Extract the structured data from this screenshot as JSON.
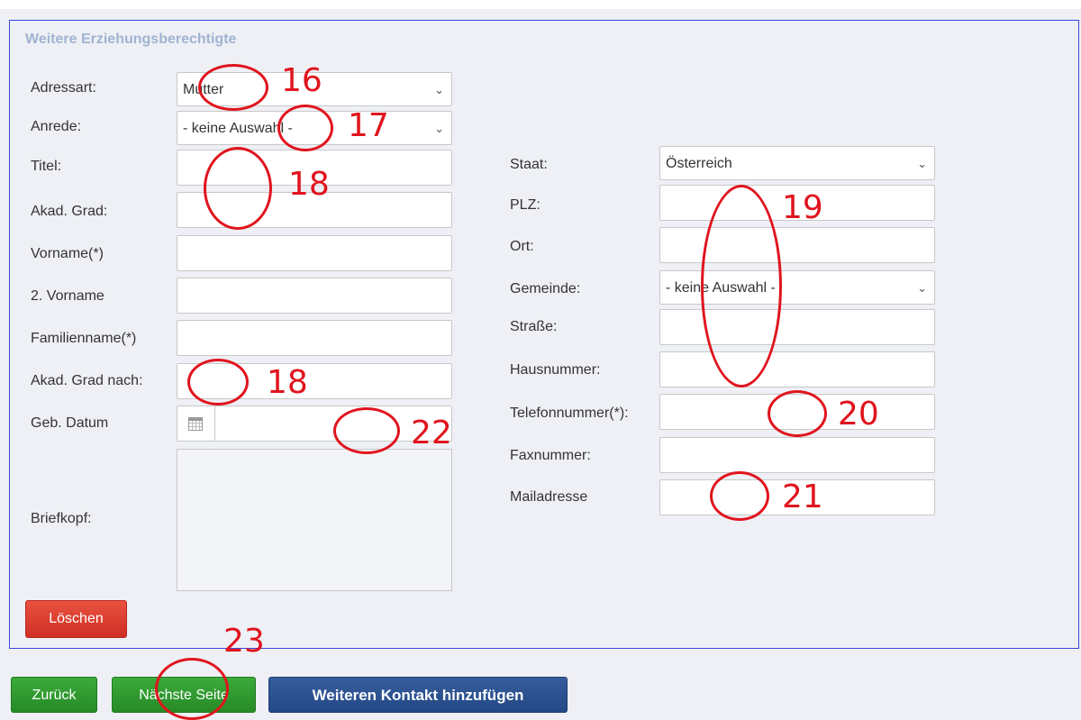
{
  "section_title": "Weitere Erziehungsberechtigte",
  "left": {
    "adressart_label": "Adressart:",
    "adressart_value": "Mutter",
    "anrede_label": "Anrede:",
    "anrede_value": "- keine Auswahl -",
    "titel_label": "Titel:",
    "akad_grad_label": "Akad. Grad:",
    "vorname_label": "Vorname(*)",
    "vorname2_label": "2. Vorname",
    "familienname_label": "Familienname(*)",
    "akad_grad_nach_label": "Akad. Grad nach:",
    "geb_datum_label": "Geb. Datum",
    "briefkopf_label": "Briefkopf:"
  },
  "right": {
    "staat_label": "Staat:",
    "staat_value": "Österreich",
    "plz_label": "PLZ:",
    "ort_label": "Ort:",
    "gemeinde_label": "Gemeinde:",
    "gemeinde_value": "- keine Auswahl -",
    "strasse_label": "Straße:",
    "hausnummer_label": "Hausnummer:",
    "telefon_label": "Telefonnummer(*):",
    "fax_label": "Faxnummer:",
    "mail_label": "Mailadresse"
  },
  "buttons": {
    "loeschen": "Löschen",
    "zurueck": "Zurück",
    "naechste": "Nächste Seite",
    "weiteren": "Weiteren Kontakt hinzufügen"
  },
  "annotations": [
    "16",
    "17",
    "18",
    "18",
    "22",
    "19",
    "20",
    "21",
    "23"
  ],
  "colors": {
    "annotation": "#e0141e",
    "panel_border": "#3a48d6",
    "section_title": "#9fb3d1",
    "delete_button": "#d9372c",
    "green_button": "#2e9a2e",
    "blue_button": "#2c4f8f"
  },
  "icons": {
    "date_picker": "calendar-icon",
    "select": "chevron-down-icon"
  }
}
